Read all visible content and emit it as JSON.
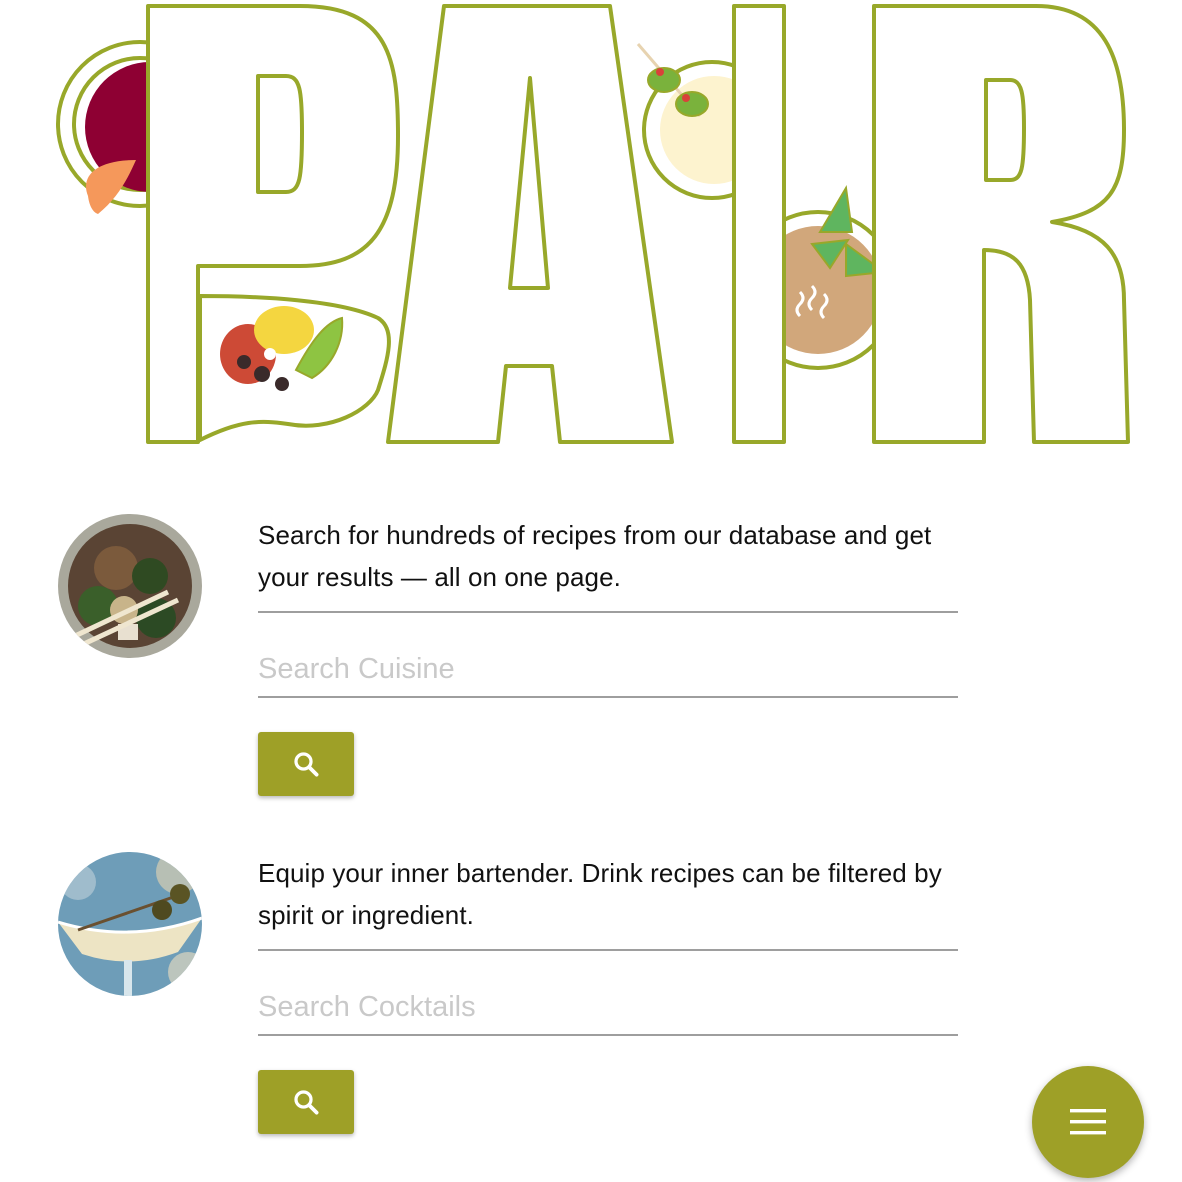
{
  "brand": {
    "logo_text": "PAIR",
    "accent_color": "#9ea027",
    "outline_color": "#98a82a"
  },
  "sections": [
    {
      "id": "cuisine",
      "image": "noodle-bowl-photo",
      "description": "Search for hundreds of recipes from our database and get your results — all on one page.",
      "input_placeholder": "Search Cuisine",
      "input_value": "",
      "button_icon": "search-icon"
    },
    {
      "id": "cocktails",
      "image": "cocktail-photo",
      "description": "Equip your inner bartender. Drink recipes can be filtered by spirit or ingredient.",
      "input_placeholder": "Search Cocktails",
      "input_value": "",
      "button_icon": "search-icon"
    }
  ],
  "fab": {
    "icon": "menu-icon"
  }
}
